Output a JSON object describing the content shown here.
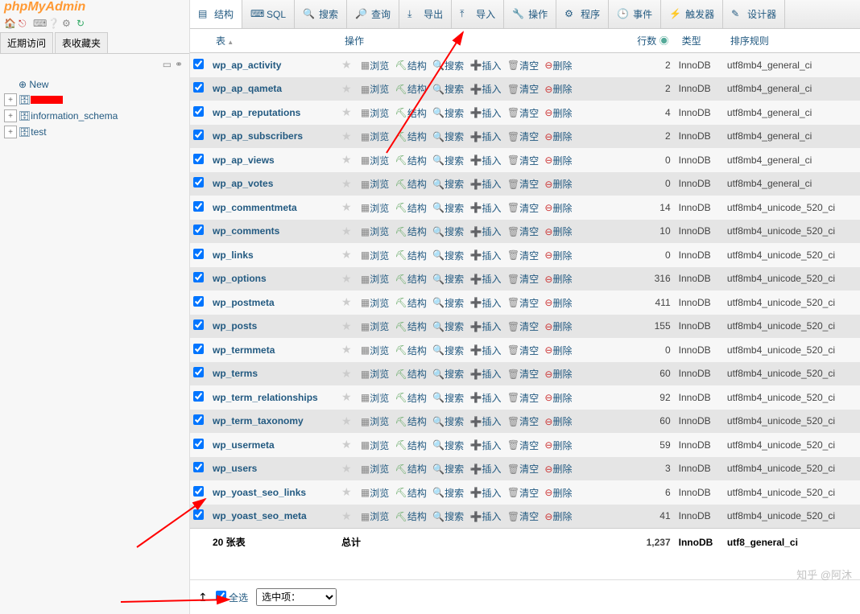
{
  "logo": "phpMyAdmin",
  "sidebar_tabs": {
    "recent": "近期访问",
    "fav": "表收藏夹"
  },
  "tree": {
    "new": "New",
    "items": [
      {
        "label": "",
        "redacted": true
      },
      {
        "label": "information_schema"
      },
      {
        "label": "test"
      }
    ]
  },
  "top_tabs": [
    {
      "label": "结构"
    },
    {
      "label": "SQL"
    },
    {
      "label": "搜索"
    },
    {
      "label": "查询"
    },
    {
      "label": "导出"
    },
    {
      "label": "导入"
    },
    {
      "label": "操作"
    },
    {
      "label": "程序"
    },
    {
      "label": "事件"
    },
    {
      "label": "触发器"
    },
    {
      "label": "设计器"
    }
  ],
  "columns": {
    "table": "表",
    "action": "操作",
    "rows": "行数",
    "type": "类型",
    "collation": "排序规则"
  },
  "row_actions": {
    "browse": "浏览",
    "structure": "结构",
    "search": "搜索",
    "insert": "插入",
    "empty": "清空",
    "drop": "删除"
  },
  "tables": [
    {
      "name": "wp_ap_activity",
      "rows": 2,
      "type": "InnoDB",
      "coll": "utf8mb4_general_ci"
    },
    {
      "name": "wp_ap_qameta",
      "rows": 2,
      "type": "InnoDB",
      "coll": "utf8mb4_general_ci"
    },
    {
      "name": "wp_ap_reputations",
      "rows": 4,
      "type": "InnoDB",
      "coll": "utf8mb4_general_ci"
    },
    {
      "name": "wp_ap_subscribers",
      "rows": 2,
      "type": "InnoDB",
      "coll": "utf8mb4_general_ci"
    },
    {
      "name": "wp_ap_views",
      "rows": 0,
      "type": "InnoDB",
      "coll": "utf8mb4_general_ci"
    },
    {
      "name": "wp_ap_votes",
      "rows": 0,
      "type": "InnoDB",
      "coll": "utf8mb4_general_ci"
    },
    {
      "name": "wp_commentmeta",
      "rows": 14,
      "type": "InnoDB",
      "coll": "utf8mb4_unicode_520_ci"
    },
    {
      "name": "wp_comments",
      "rows": 10,
      "type": "InnoDB",
      "coll": "utf8mb4_unicode_520_ci"
    },
    {
      "name": "wp_links",
      "rows": 0,
      "type": "InnoDB",
      "coll": "utf8mb4_unicode_520_ci"
    },
    {
      "name": "wp_options",
      "rows": 316,
      "type": "InnoDB",
      "coll": "utf8mb4_unicode_520_ci"
    },
    {
      "name": "wp_postmeta",
      "rows": 411,
      "type": "InnoDB",
      "coll": "utf8mb4_unicode_520_ci"
    },
    {
      "name": "wp_posts",
      "rows": 155,
      "type": "InnoDB",
      "coll": "utf8mb4_unicode_520_ci"
    },
    {
      "name": "wp_termmeta",
      "rows": 0,
      "type": "InnoDB",
      "coll": "utf8mb4_unicode_520_ci"
    },
    {
      "name": "wp_terms",
      "rows": 60,
      "type": "InnoDB",
      "coll": "utf8mb4_unicode_520_ci"
    },
    {
      "name": "wp_term_relationships",
      "rows": 92,
      "type": "InnoDB",
      "coll": "utf8mb4_unicode_520_ci"
    },
    {
      "name": "wp_term_taxonomy",
      "rows": 60,
      "type": "InnoDB",
      "coll": "utf8mb4_unicode_520_ci"
    },
    {
      "name": "wp_usermeta",
      "rows": 59,
      "type": "InnoDB",
      "coll": "utf8mb4_unicode_520_ci"
    },
    {
      "name": "wp_users",
      "rows": 3,
      "type": "InnoDB",
      "coll": "utf8mb4_unicode_520_ci"
    },
    {
      "name": "wp_yoast_seo_links",
      "rows": 6,
      "type": "InnoDB",
      "coll": "utf8mb4_unicode_520_ci"
    },
    {
      "name": "wp_yoast_seo_meta",
      "rows": 41,
      "type": "InnoDB",
      "coll": "utf8mb4_unicode_520_ci"
    }
  ],
  "total": {
    "label": "20 张表",
    "sum_label": "总计",
    "rows": "1,237",
    "type": "InnoDB",
    "coll": "utf8_general_ci"
  },
  "footer": {
    "check_all": "全选",
    "with_selected": "选中项："
  },
  "watermark": "知乎 @阿沐"
}
